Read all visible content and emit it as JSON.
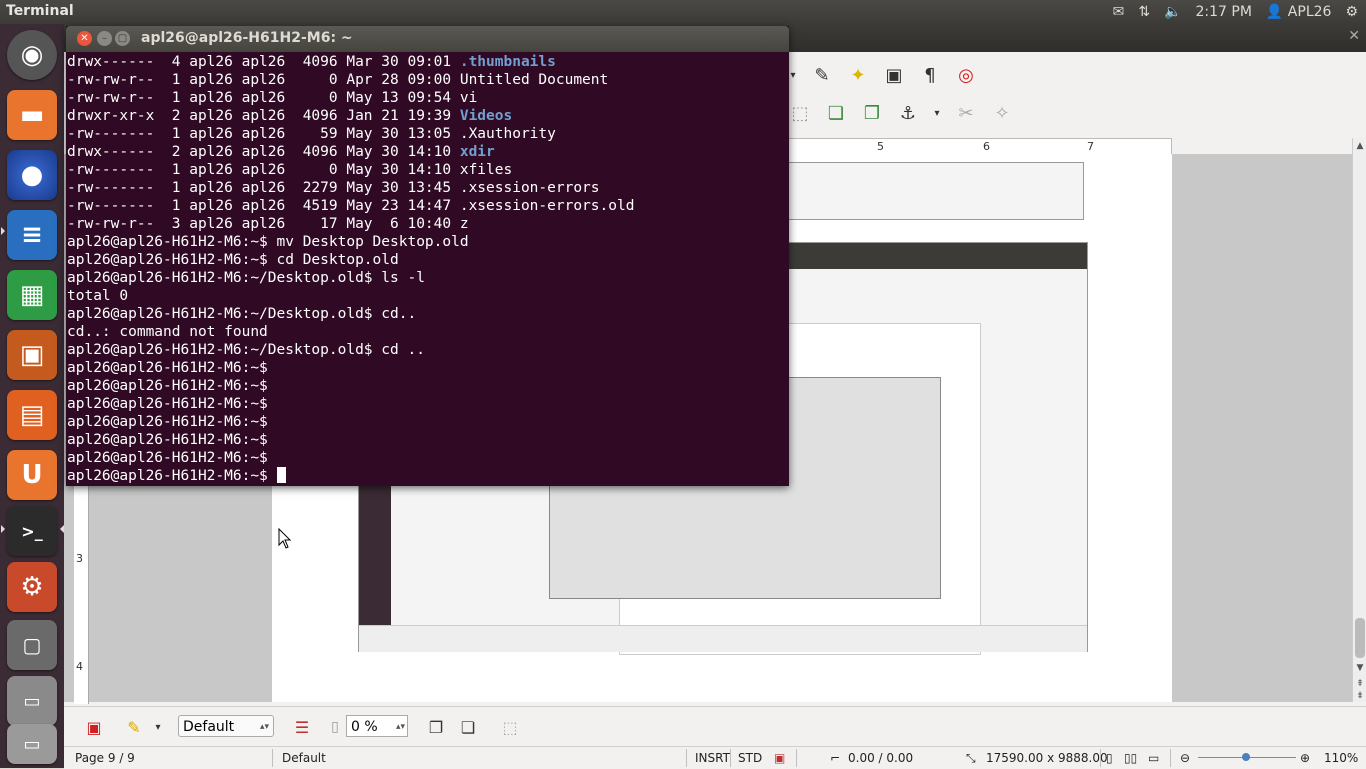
{
  "top_panel": {
    "app_title": "Terminal",
    "time": "2:17 PM",
    "user": "APL26",
    "icons": [
      "mail-icon",
      "network-icon",
      "volume-icon",
      "user-icon",
      "gear-icon"
    ]
  },
  "launcher": {
    "items": [
      "ubuntu-home",
      "files",
      "firefox",
      "libreoffice-writer",
      "libreoffice-calc",
      "libreoffice-impress",
      "software-center",
      "ubuntu-one",
      "terminal",
      "system-settings",
      "workspace-switcher",
      "drive",
      "trash"
    ]
  },
  "terminal": {
    "title": "apl26@apl26-H61H2-M6: ~",
    "lines": [
      {
        "pre": "drwx------  4 apl26 apl26  4096 Mar 30 09:01 ",
        "dir": ".thumbnails"
      },
      {
        "pre": "-rw-rw-r--  1 apl26 apl26     0 Apr 28 09:00 Untitled Document",
        "dir": ""
      },
      {
        "pre": "-rw-rw-r--  1 apl26 apl26     0 May 13 09:54 vi",
        "dir": ""
      },
      {
        "pre": "drwxr-xr-x  2 apl26 apl26  4096 Jan 21 19:39 ",
        "dir": "Videos"
      },
      {
        "pre": "-rw-------  1 apl26 apl26    59 May 30 13:05 .Xauthority",
        "dir": ""
      },
      {
        "pre": "drwx------  2 apl26 apl26  4096 May 30 14:10 ",
        "dir": "xdir"
      },
      {
        "pre": "-rw-------  1 apl26 apl26     0 May 30 14:10 xfiles",
        "dir": ""
      },
      {
        "pre": "-rw-------  1 apl26 apl26  2279 May 30 13:45 .xsession-errors",
        "dir": ""
      },
      {
        "pre": "-rw-------  1 apl26 apl26  4519 May 23 14:47 .xsession-errors.old",
        "dir": ""
      },
      {
        "pre": "-rw-rw-r--  3 apl26 apl26    17 May  6 10:40 z",
        "dir": ""
      },
      {
        "pre": "apl26@apl26-H61H2-M6:~$ mv Desktop Desktop.old",
        "dir": ""
      },
      {
        "pre": "apl26@apl26-H61H2-M6:~$ cd Desktop.old",
        "dir": ""
      },
      {
        "pre": "apl26@apl26-H61H2-M6:~/Desktop.old$ ls -l",
        "dir": ""
      },
      {
        "pre": "total 0",
        "dir": ""
      },
      {
        "pre": "apl26@apl26-H61H2-M6:~/Desktop.old$ cd..",
        "dir": ""
      },
      {
        "pre": "cd..: command not found",
        "dir": ""
      },
      {
        "pre": "apl26@apl26-H61H2-M6:~/Desktop.old$ cd ..",
        "dir": ""
      },
      {
        "pre": "apl26@apl26-H61H2-M6:~$",
        "dir": ""
      },
      {
        "pre": "apl26@apl26-H61H2-M6:~$",
        "dir": ""
      },
      {
        "pre": "apl26@apl26-H61H2-M6:~$",
        "dir": ""
      },
      {
        "pre": "apl26@apl26-H61H2-M6:~$",
        "dir": ""
      },
      {
        "pre": "apl26@apl26-H61H2-M6:~$",
        "dir": ""
      },
      {
        "pre": "apl26@apl26-H61H2-M6:~$",
        "dir": ""
      }
    ],
    "prompt": "apl26@apl26-H61H2-M6:~$ "
  },
  "writer": {
    "ruler_marks": [
      "5",
      "6",
      "7"
    ],
    "left_ruler_marks": [
      "3",
      "4"
    ],
    "style_select": "Default",
    "transparency": "0 %",
    "status": {
      "page": "Page 9 / 9",
      "page_style": "Default",
      "insert_mode": "INSRT",
      "selection_mode": "STD",
      "position": "0.00 / 0.00",
      "size": "17590.00 x 9888.00",
      "zoom": "110%"
    }
  }
}
